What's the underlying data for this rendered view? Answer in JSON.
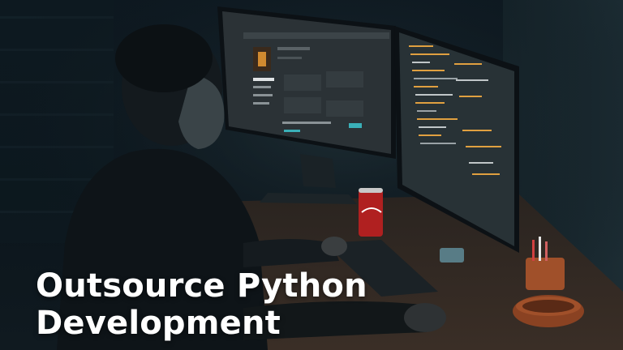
{
  "headline": {
    "line1": "Outsource Python",
    "line2": "Development"
  },
  "scene": {
    "subject": "person-at-dual-monitors",
    "colors": {
      "background": "#0b151c",
      "screen_glow": "#2a3a40",
      "code_orange": "#e0a040",
      "can_red": "#b02020",
      "cup_terracotta": "#a0502a",
      "headline_text": "#ffffff"
    }
  }
}
